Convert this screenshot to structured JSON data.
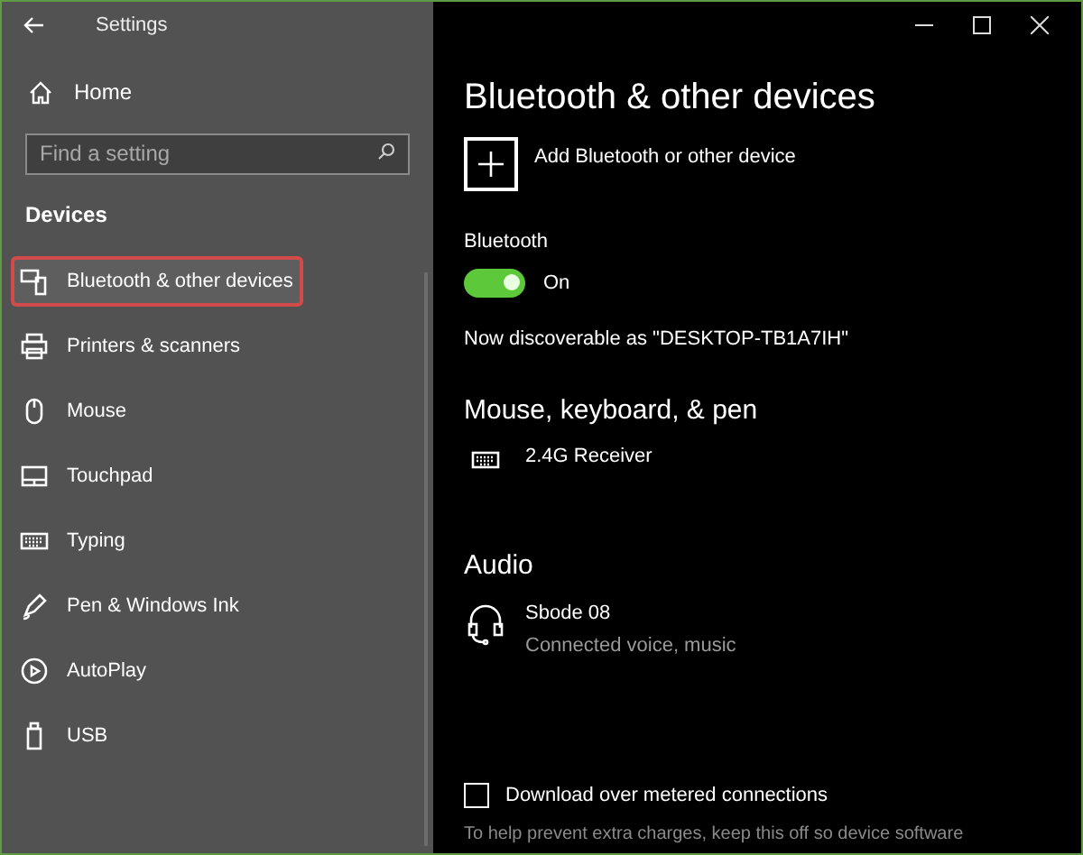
{
  "window": {
    "title": "Settings"
  },
  "sidebar": {
    "home": "Home",
    "search": {
      "placeholder": "Find a setting"
    },
    "section": "Devices",
    "items": [
      {
        "label": "Bluetooth & other devices",
        "kind": "bluetooth",
        "selected": true
      },
      {
        "label": "Printers & scanners",
        "kind": "printer",
        "selected": false
      },
      {
        "label": "Mouse",
        "kind": "mouse",
        "selected": false
      },
      {
        "label": "Touchpad",
        "kind": "touchpad",
        "selected": false
      },
      {
        "label": "Typing",
        "kind": "keyboard",
        "selected": false
      },
      {
        "label": "Pen & Windows Ink",
        "kind": "pen",
        "selected": false
      },
      {
        "label": "AutoPlay",
        "kind": "autoplay",
        "selected": false
      },
      {
        "label": "USB",
        "kind": "usb",
        "selected": false
      }
    ]
  },
  "main": {
    "title": "Bluetooth & other devices",
    "add_button": "Add Bluetooth or other device",
    "bluetooth": {
      "label": "Bluetooth",
      "on": true,
      "state_text": "On"
    },
    "discoverable": "Now discoverable as \"DESKTOP-TB1A7IH\"",
    "sections": [
      {
        "heading": "Mouse, keyboard, & pen",
        "devices": [
          {
            "kind": "keyboard",
            "name": "2.4G Receiver"
          }
        ]
      },
      {
        "heading": "Audio",
        "devices": [
          {
            "kind": "headset",
            "name": "Sbode 08",
            "status": "Connected voice, music"
          }
        ]
      }
    ],
    "metered": {
      "label": "Download over metered connections",
      "checked": false
    },
    "note": "To help prevent extra charges, keep this off so device software"
  }
}
